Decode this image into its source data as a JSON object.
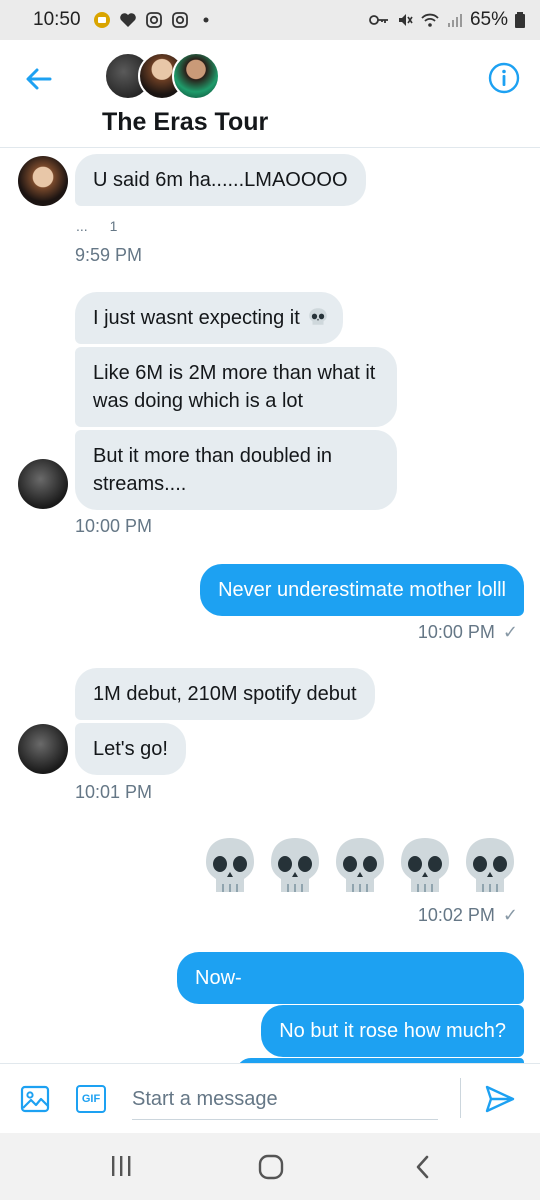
{
  "status_bar": {
    "time": "10:50",
    "battery": "65%"
  },
  "header": {
    "group_name": "The Eras Tour"
  },
  "messages": {
    "m1": "U said 6m ha......LMAOOOO",
    "m1_reaction_dots": "...",
    "m1_reaction_count": "1",
    "ts1": "9:59 PM",
    "m2": "I just wasnt expecting it",
    "m3": "Like 6M is 2M more than what it was doing which is a lot",
    "m4": "But it more than doubled in streams....",
    "ts2": "10:00 PM",
    "m5": "Never underestimate mother lolll",
    "ts3": "10:00 PM",
    "m6": "1M debut, 210M spotify debut",
    "m7": "Let's go!",
    "ts4": "10:01 PM",
    "ts5": "10:02 PM",
    "m8": "Now-",
    "m9": "No but it rose how much?"
  },
  "composer": {
    "placeholder": "Start a message",
    "gif_label": "GIF"
  },
  "colors": {
    "accent": "#1da1f2",
    "incoming_bubble": "#e6ecf0"
  }
}
